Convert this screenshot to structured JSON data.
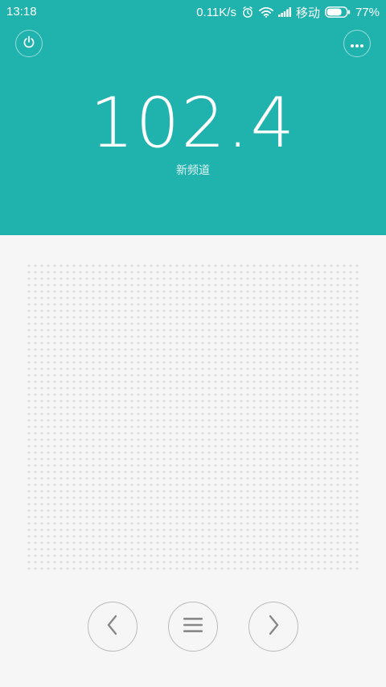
{
  "status_bar": {
    "time": "13:18",
    "net_speed": "0.11K/s",
    "carrier": "移动",
    "battery": "77%",
    "battery_level": 0.77,
    "icons": [
      "alarm-icon",
      "wifi-icon",
      "signal-icon",
      "battery-icon"
    ]
  },
  "radio": {
    "frequency": "102.4",
    "station_name": "新频道"
  },
  "controls": {
    "power": "power-icon",
    "more": "more-icon",
    "prev": "chevron-left-icon",
    "menu": "menu-icon",
    "next": "chevron-right-icon"
  },
  "colors": {
    "accent": "#20b2ad",
    "background": "#f6f6f6",
    "dot": "#dcdcdc",
    "control_border": "#b9b9b9",
    "control_icon": "#888888"
  }
}
